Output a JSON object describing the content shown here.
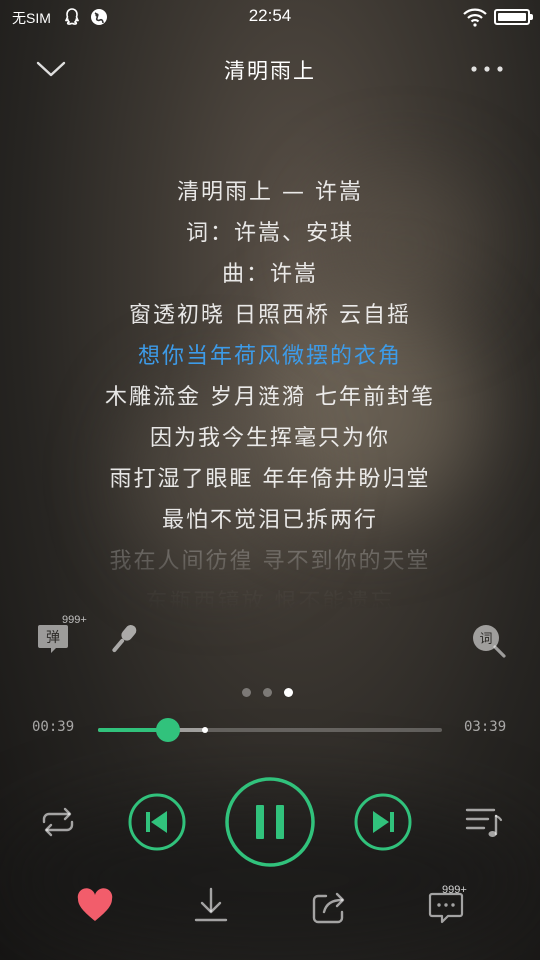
{
  "status_bar": {
    "sim": "无SIM",
    "time": "22:54",
    "battery_level": 1.0
  },
  "header": {
    "title": "清明雨上",
    "back_icon": "chevron-down-icon",
    "more_icon": "more-dots-icon"
  },
  "lyrics": [
    {
      "text": "清明雨上 — 许嵩",
      "state": "normal"
    },
    {
      "text": "词：许嵩、安琪",
      "state": "normal"
    },
    {
      "text": "曲：许嵩",
      "state": "normal"
    },
    {
      "text": "窗透初晓 日照西桥 云自摇",
      "state": "normal"
    },
    {
      "text": "想你当年荷风微摆的衣角",
      "state": "active"
    },
    {
      "text": "木雕流金 岁月涟漪 七年前封笔",
      "state": "normal"
    },
    {
      "text": "因为我今生挥毫只为你",
      "state": "normal"
    },
    {
      "text": "雨打湿了眼眶 年年倚井盼归堂",
      "state": "normal"
    },
    {
      "text": "最怕不觉泪已拆两行",
      "state": "normal"
    },
    {
      "text": "我在人间彷徨 寻不到你的天堂",
      "state": "dim"
    },
    {
      "text": "东瓶西镜放 恨不能遗忘",
      "state": "dimmer"
    }
  ],
  "tools": {
    "danmu_label": "弹",
    "danmu_count": "999+",
    "lyric_search_label": "词"
  },
  "pager": {
    "count": 3,
    "active_index": 2
  },
  "progress": {
    "current": "00:39",
    "total": "03:39",
    "played_fraction": 0.203,
    "buffered_fraction": 0.31
  },
  "controls": {
    "state": "playing",
    "accent_color": "#31c27c"
  },
  "bottom": {
    "favorited": true,
    "favorite_color": "#f25d6b",
    "comment_count": "999+"
  },
  "colors": {
    "active_lyric": "#3d9be8",
    "accent": "#31c27c"
  }
}
